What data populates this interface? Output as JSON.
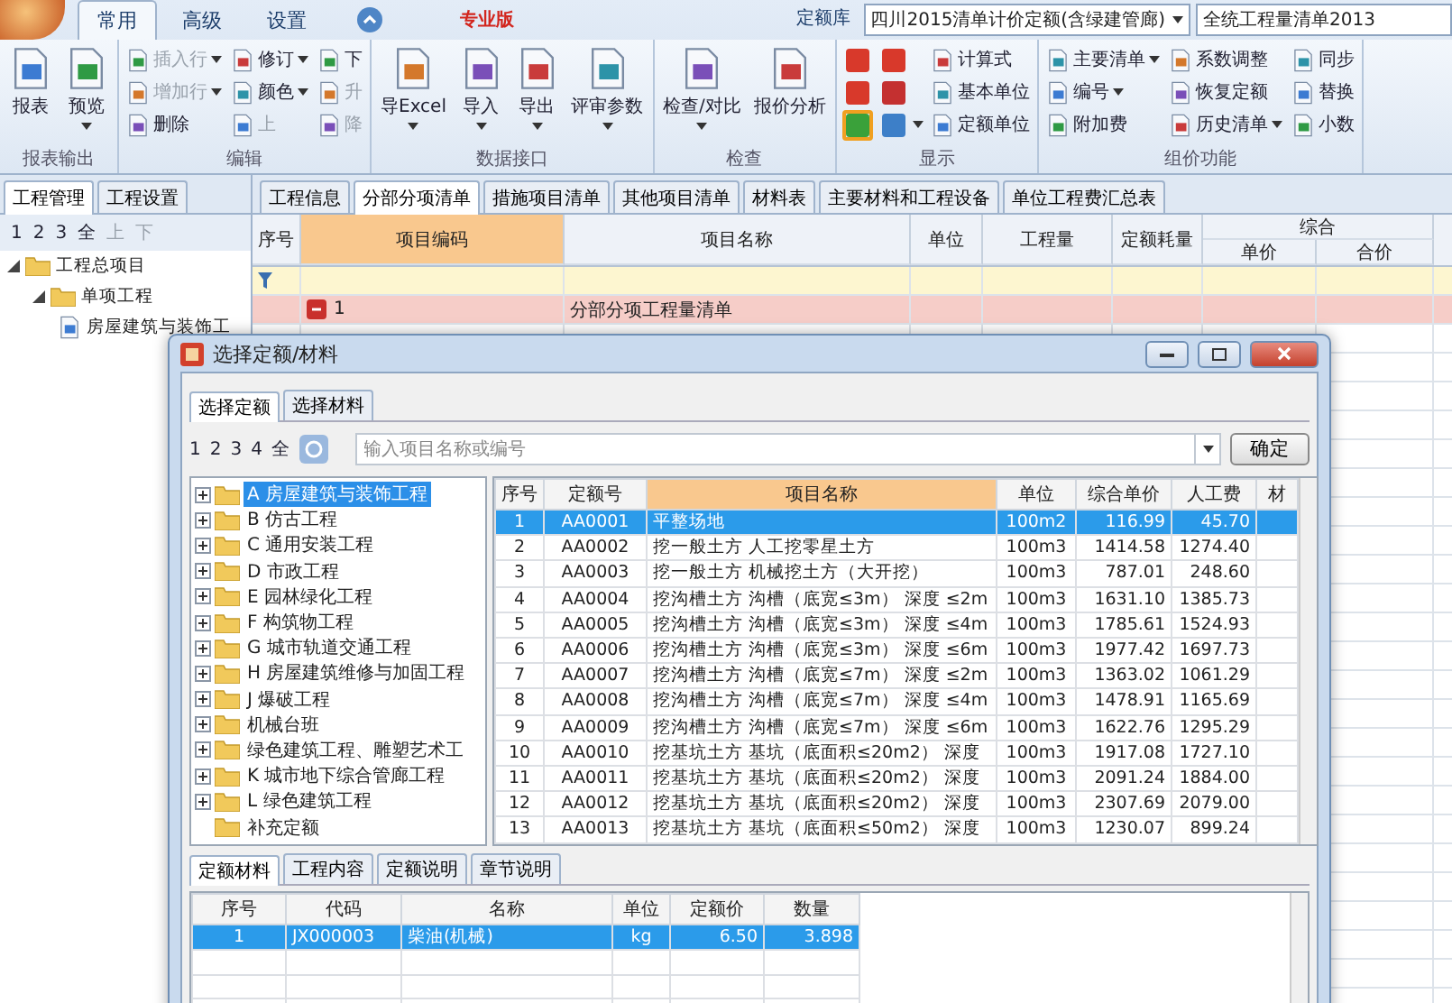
{
  "ribbon": {
    "tabs": [
      {
        "label": "常用",
        "selected": true
      },
      {
        "label": "高级",
        "selected": false
      },
      {
        "label": "设置",
        "selected": false
      }
    ],
    "edition": "专业版",
    "library_label": "定额库",
    "library": "四川2015清单计价定额(含绿建管廊)",
    "list_library": "全统工程量清单2013",
    "groups": [
      {
        "label": "报表输出",
        "items": [
          {
            "kind": "big",
            "label": "报表",
            "menu": false
          },
          {
            "kind": "big",
            "label": "预览",
            "menu": true
          }
        ]
      },
      {
        "label": "编辑",
        "items": [
          {
            "kind": "small",
            "label": "插入行",
            "menu": true,
            "disabled": true
          },
          {
            "kind": "small",
            "label": "增加行",
            "menu": true,
            "disabled": true
          },
          {
            "kind": "small",
            "label": "删除",
            "menu": false,
            "disabled": false
          },
          {
            "kind": "small",
            "label": "修订",
            "menu": true,
            "disabled": false
          },
          {
            "kind": "small",
            "label": "颜色",
            "menu": true,
            "disabled": false
          },
          {
            "kind": "small",
            "label": "上",
            "menu": false,
            "disabled": true
          },
          {
            "kind": "small",
            "label": "下",
            "menu": false,
            "disabled": false
          },
          {
            "kind": "small",
            "label": "升",
            "menu": false,
            "disabled": true
          },
          {
            "kind": "small",
            "label": "降",
            "menu": false,
            "disabled": true
          }
        ]
      },
      {
        "label": "数据接口",
        "items": [
          {
            "kind": "big",
            "label": "导Excel",
            "menu": true
          },
          {
            "kind": "big",
            "label": "导入",
            "menu": true
          },
          {
            "kind": "big",
            "label": "导出",
            "menu": true
          },
          {
            "kind": "big",
            "label": "评审参数",
            "menu": true
          }
        ]
      },
      {
        "label": "检查",
        "items": [
          {
            "kind": "big",
            "label": "检查/对比",
            "menu": true
          },
          {
            "kind": "big",
            "label": "报价分析",
            "menu": false
          }
        ]
      },
      {
        "label": "显示",
        "items": [
          {
            "kind": "toggle",
            "color": "#d8392b",
            "selected": false
          },
          {
            "kind": "toggle",
            "color": "#d8392b",
            "selected": false
          },
          {
            "kind": "toggle",
            "color": "#3aa13a",
            "selected": true
          },
          {
            "kind": "toggle",
            "color": "#d8392b",
            "selected": false
          },
          {
            "kind": "toggle",
            "color": "#c43030",
            "selected": false
          },
          {
            "kind": "toggle",
            "color": "#3d7fc8",
            "selected": false,
            "menu": true
          },
          {
            "kind": "small",
            "label": "计算式",
            "menu": false,
            "disabled": false
          },
          {
            "kind": "small",
            "label": "基本单位",
            "menu": false,
            "disabled": false
          },
          {
            "kind": "small",
            "label": "定额单位",
            "menu": false,
            "disabled": false
          }
        ]
      },
      {
        "label": "组价功能",
        "items": [
          {
            "kind": "small",
            "label": "主要清单",
            "menu": true,
            "disabled": false
          },
          {
            "kind": "small",
            "label": "编号",
            "menu": true,
            "disabled": false
          },
          {
            "kind": "small",
            "label": "附加费",
            "menu": false,
            "disabled": false
          },
          {
            "kind": "small",
            "label": "系数调整",
            "menu": false,
            "disabled": false
          },
          {
            "kind": "small",
            "label": "恢复定额",
            "menu": false,
            "disabled": false
          },
          {
            "kind": "small",
            "label": "历史清单",
            "menu": true,
            "disabled": false
          },
          {
            "kind": "small",
            "label": "同步",
            "menu": false,
            "disabled": false
          },
          {
            "kind": "small",
            "label": "替换",
            "menu": false,
            "disabled": false
          },
          {
            "kind": "small",
            "label": "小数",
            "menu": false,
            "disabled": false
          }
        ]
      }
    ]
  },
  "left_panel": {
    "tabs": [
      {
        "label": "工程管理",
        "selected": true
      },
      {
        "label": "工程设置",
        "selected": false
      }
    ],
    "levels": [
      {
        "label": "1",
        "disabled": false
      },
      {
        "label": "2",
        "disabled": false
      },
      {
        "label": "3",
        "disabled": false
      },
      {
        "label": "全",
        "disabled": false
      },
      {
        "label": "上",
        "disabled": true
      },
      {
        "label": "下",
        "disabled": true
      }
    ],
    "tree": [
      {
        "label": "工程总项目",
        "expanded": true,
        "children": [
          {
            "label": "单项工程",
            "expanded": true,
            "children": [
              {
                "label": "房屋建筑与装饰工"
              }
            ]
          }
        ]
      }
    ]
  },
  "main": {
    "tabs": [
      {
        "label": "工程信息",
        "selected": false
      },
      {
        "label": "分部分项清单",
        "selected": true
      },
      {
        "label": "措施项目清单",
        "selected": false
      },
      {
        "label": "其他项目清单",
        "selected": false
      },
      {
        "label": "材料表",
        "selected": false
      },
      {
        "label": "主要材料和工程设备",
        "selected": false
      },
      {
        "label": "单位工程费汇总表",
        "selected": false
      }
    ],
    "table": {
      "columns": [
        {
          "label": "序号",
          "selected": false
        },
        {
          "label": "项目编码",
          "selected": true
        },
        {
          "label": "项目名称",
          "selected": false
        },
        {
          "label": "单位",
          "selected": false
        },
        {
          "label": "工程量",
          "selected": false
        },
        {
          "label": "定额耗量",
          "selected": false
        }
      ],
      "group": {
        "label": "综合",
        "columns": [
          "单价",
          "合价"
        ]
      },
      "rows": [
        {
          "kind": "filter"
        },
        {
          "kind": "section",
          "expanded": true,
          "code": "1",
          "name": "分部分项工程量清单"
        }
      ]
    }
  },
  "dialog": {
    "title": "选择定额/材料",
    "tabs": [
      {
        "label": "选择定额",
        "selected": true
      },
      {
        "label": "选择材料",
        "selected": false
      }
    ],
    "levels": [
      "1",
      "2",
      "3",
      "4",
      "全"
    ],
    "search": {
      "placeholder": "输入项目名称或编号"
    },
    "confirm": "确定",
    "tree": [
      {
        "label": "A 房屋建筑与装饰工程",
        "selected": true,
        "expandable": true
      },
      {
        "label": "B 仿古工程",
        "selected": false,
        "expandable": true
      },
      {
        "label": "C 通用安装工程",
        "selected": false,
        "expandable": true
      },
      {
        "label": "D 市政工程",
        "selected": false,
        "expandable": true
      },
      {
        "label": "E 园林绿化工程",
        "selected": false,
        "expandable": true
      },
      {
        "label": "F 构筑物工程",
        "selected": false,
        "expandable": true
      },
      {
        "label": "G 城市轨道交通工程",
        "selected": false,
        "expandable": true
      },
      {
        "label": "H 房屋建筑维修与加固工程",
        "selected": false,
        "expandable": true
      },
      {
        "label": "J 爆破工程",
        "selected": false,
        "expandable": true
      },
      {
        "label": "机械台班",
        "selected": false,
        "expandable": true
      },
      {
        "label": "绿色建筑工程、雕塑艺术工",
        "selected": false,
        "expandable": true
      },
      {
        "label": "K 城市地下综合管廊工程",
        "selected": false,
        "expandable": true
      },
      {
        "label": "L 绿色建筑工程",
        "selected": false,
        "expandable": true
      },
      {
        "label": "补充定额",
        "selected": false,
        "expandable": false
      }
    ],
    "table": {
      "columns": [
        {
          "label": "序号",
          "selected": false
        },
        {
          "label": "定额号",
          "selected": false
        },
        {
          "label": "项目名称",
          "selected": true
        },
        {
          "label": "单位",
          "selected": false
        },
        {
          "label": "综合单价",
          "selected": false
        },
        {
          "label": "人工费",
          "selected": false
        },
        {
          "label": "材",
          "selected": false
        }
      ],
      "rows": [
        {
          "no": "1",
          "code": "AA0001",
          "name": "平整场地",
          "unit": "100m2",
          "price": "116.99",
          "labor": "45.70",
          "selected": true
        },
        {
          "no": "2",
          "code": "AA0002",
          "name": "挖一般土方 人工挖零星土方",
          "unit": "100m3",
          "price": "1414.58",
          "labor": "1274.40",
          "selected": false
        },
        {
          "no": "3",
          "code": "AA0003",
          "name": "挖一般土方 机械挖土方（大开挖）",
          "unit": "100m3",
          "price": "787.01",
          "labor": "248.60",
          "selected": false
        },
        {
          "no": "4",
          "code": "AA0004",
          "name": "挖沟槽土方 沟槽（底宽≤3m） 深度 ≤2m",
          "unit": "100m3",
          "price": "1631.10",
          "labor": "1385.73",
          "selected": false
        },
        {
          "no": "5",
          "code": "AA0005",
          "name": "挖沟槽土方 沟槽（底宽≤3m） 深度 ≤4m",
          "unit": "100m3",
          "price": "1785.61",
          "labor": "1524.93",
          "selected": false
        },
        {
          "no": "6",
          "code": "AA0006",
          "name": "挖沟槽土方 沟槽（底宽≤3m） 深度 ≤6m",
          "unit": "100m3",
          "price": "1977.42",
          "labor": "1697.73",
          "selected": false
        },
        {
          "no": "7",
          "code": "AA0007",
          "name": "挖沟槽土方 沟槽（底宽≤7m） 深度 ≤2m",
          "unit": "100m3",
          "price": "1363.02",
          "labor": "1061.29",
          "selected": false
        },
        {
          "no": "8",
          "code": "AA0008",
          "name": "挖沟槽土方 沟槽（底宽≤7m） 深度 ≤4m",
          "unit": "100m3",
          "price": "1478.91",
          "labor": "1165.69",
          "selected": false
        },
        {
          "no": "9",
          "code": "AA0009",
          "name": "挖沟槽土方 沟槽（底宽≤7m） 深度 ≤6m",
          "unit": "100m3",
          "price": "1622.76",
          "labor": "1295.29",
          "selected": false
        },
        {
          "no": "10",
          "code": "AA0010",
          "name": "挖基坑土方 基坑（底面积≤20m2） 深度",
          "unit": "100m3",
          "price": "1917.08",
          "labor": "1727.10",
          "selected": false
        },
        {
          "no": "11",
          "code": "AA0011",
          "name": "挖基坑土方 基坑（底面积≤20m2） 深度",
          "unit": "100m3",
          "price": "2091.24",
          "labor": "1884.00",
          "selected": false
        },
        {
          "no": "12",
          "code": "AA0012",
          "name": "挖基坑土方 基坑（底面积≤20m2） 深度",
          "unit": "100m3",
          "price": "2307.69",
          "labor": "2079.00",
          "selected": false
        },
        {
          "no": "13",
          "code": "AA0013",
          "name": "挖基坑土方 基坑（底面积≤50m2） 深度",
          "unit": "100m3",
          "price": "1230.07",
          "labor": "899.24",
          "selected": false
        }
      ]
    },
    "detail_tabs": [
      {
        "label": "定额材料",
        "selected": true
      },
      {
        "label": "工程内容",
        "selected": false
      },
      {
        "label": "定额说明",
        "selected": false
      },
      {
        "label": "章节说明",
        "selected": false
      }
    ],
    "detail_table": {
      "columns": [
        "序号",
        "代码",
        "名称",
        "单位",
        "定额价",
        "数量"
      ],
      "rows": [
        {
          "no": "1",
          "code": "JX000003",
          "name": "柴油(机械)",
          "unit": "kg",
          "price": "6.50",
          "qty": "3.898",
          "selected": true
        }
      ]
    }
  }
}
